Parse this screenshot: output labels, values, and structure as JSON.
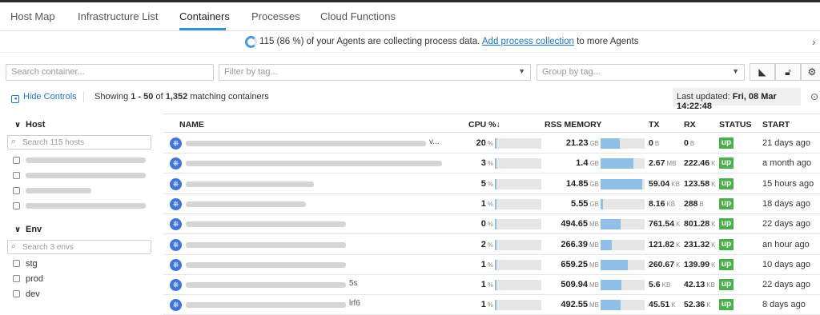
{
  "tabs": [
    {
      "label": "Host Map"
    },
    {
      "label": "Infrastructure List"
    },
    {
      "label": "Containers"
    },
    {
      "label": "Processes"
    },
    {
      "label": "Cloud Functions"
    }
  ],
  "banner": {
    "percent": 0.86,
    "text": "115 (86 %) of your Agents are collecting process data.",
    "link": "Add process collection",
    "suffix": "to more Agents"
  },
  "filters": {
    "search_placeholder": "Search container...",
    "tag_placeholder": "Filter by tag...",
    "group_placeholder": "Group by tag..."
  },
  "controls": {
    "hide_label": "Hide Controls",
    "showing_prefix": "Showing",
    "showing_range": "1 - 50",
    "showing_of": "of",
    "showing_total": "1,352",
    "showing_suffix": "matching containers",
    "last_updated_label": "Last updated:",
    "last_updated_value": "Fri, 08 Mar 14:22:48"
  },
  "sidebar": {
    "host": {
      "title": "Host",
      "search_placeholder": "Search 115 hosts"
    },
    "env": {
      "title": "Env",
      "search_placeholder": "Search 3 envs",
      "items": [
        "stg",
        "prod",
        "dev"
      ]
    }
  },
  "table": {
    "headers": {
      "name": "NAME",
      "cpu": "CPU %",
      "cpu_sort": "↓",
      "rss": "RSS MEMORY",
      "tx": "TX",
      "rx": "RX",
      "status": "STATUS",
      "start": "START"
    },
    "rows": [
      {
        "name_tail": "v...",
        "cpu": "20",
        "cpu_frac": 0.03,
        "rss": "21.23",
        "rss_unit": "GB",
        "rss_frac": 0.43,
        "tx": "0",
        "tx_unit": "B",
        "rx": "0",
        "rx_unit": "B",
        "status": "up",
        "start": "21 days ago"
      },
      {
        "name_tail": "",
        "cpu": "3",
        "cpu_frac": 0.01,
        "rss": "1.4",
        "rss_unit": "GB",
        "rss_frac": 0.75,
        "tx": "2.67",
        "tx_unit": "MB",
        "rx": "222.46",
        "rx_unit": "K",
        "status": "up",
        "start": "a month ago"
      },
      {
        "name_tail": "",
        "cpu": "5",
        "cpu_frac": 0.01,
        "rss": "14.85",
        "rss_unit": "GB",
        "rss_frac": 0.95,
        "tx": "59.04",
        "tx_unit": "KB",
        "rx": "123.58",
        "rx_unit": "K",
        "status": "up",
        "start": "15 hours ago"
      },
      {
        "name_tail": "",
        "cpu": "1",
        "cpu_frac": 0.01,
        "rss": "5.55",
        "rss_unit": "GB",
        "rss_frac": 0.05,
        "tx": "8.16",
        "tx_unit": "KB",
        "rx": "288",
        "rx_unit": "B",
        "status": "up",
        "start": "18 days ago"
      },
      {
        "name_tail": "",
        "cpu": "0",
        "cpu_frac": 0.005,
        "rss": "494.65",
        "rss_unit": "MB",
        "rss_frac": 0.45,
        "tx": "761.54",
        "tx_unit": "K",
        "rx": "801.28",
        "rx_unit": "K",
        "status": "up",
        "start": "22 days ago"
      },
      {
        "name_tail": "",
        "cpu": "2",
        "cpu_frac": 0.01,
        "rss": "266.39",
        "rss_unit": "MB",
        "rss_frac": 0.25,
        "tx": "121.82",
        "tx_unit": "K",
        "rx": "231.32",
        "rx_unit": "K",
        "status": "up",
        "start": "an hour ago"
      },
      {
        "name_tail": "",
        "cpu": "1",
        "cpu_frac": 0.01,
        "rss": "659.25",
        "rss_unit": "MB",
        "rss_frac": 0.62,
        "tx": "260.67",
        "tx_unit": "K",
        "rx": "139.99",
        "rx_unit": "K",
        "status": "up",
        "start": "10 days ago"
      },
      {
        "name_tail": "5s",
        "cpu": "1",
        "cpu_frac": 0.01,
        "rss": "509.94",
        "rss_unit": "MB",
        "rss_frac": 0.48,
        "tx": "5.6",
        "tx_unit": "KB",
        "rx": "42.13",
        "rx_unit": "KB",
        "status": "up",
        "start": "22 days ago"
      },
      {
        "name_tail": "lrf6",
        "cpu": "1",
        "cpu_frac": 0.01,
        "rss": "492.55",
        "rss_unit": "MB",
        "rss_frac": 0.46,
        "tx": "45.51",
        "tx_unit": "K",
        "rx": "52.36",
        "rx_unit": "K",
        "status": "up",
        "start": "8 days ago"
      }
    ]
  },
  "colors": {
    "accent": "#3b8fd6",
    "status_up": "#4bb04b",
    "bar": "#8fbfe6",
    "kubernetes": "#3f74d8"
  }
}
